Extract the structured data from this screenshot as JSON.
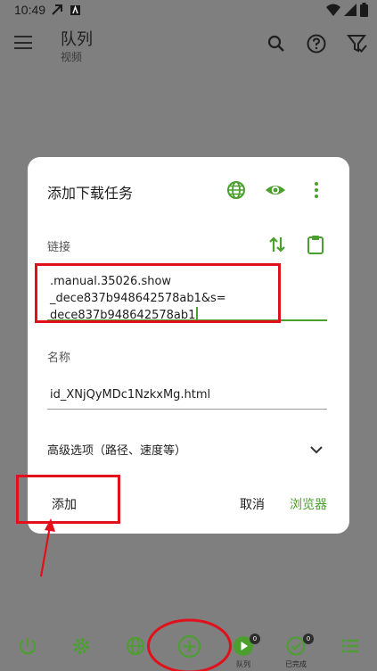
{
  "status_bar": {
    "time": "10:49"
  },
  "app_bar": {
    "title": "队列",
    "subtitle": "视频"
  },
  "dialog": {
    "title": "添加下载任务",
    "link_label": "链接",
    "link_value_line1": ".manual.35026.show",
    "link_value_line2": "_dece837b948642578ab1&s=",
    "link_value_line3": "dece837b948642578ab1",
    "name_label": "名称",
    "name_value": "id_XNjQyMDc1NzkxMg.html",
    "advanced_label": "高级选项（路径、速度等）",
    "add_button": "添加",
    "cancel_button": "取消",
    "browser_button": "浏览器"
  },
  "bottom_nav": {
    "queue_label": "队列",
    "queue_badge": "0",
    "done_label": "已完成",
    "done_badge": "0"
  },
  "colors": {
    "accent": "#4b9f2f",
    "highlight": "#e0111b",
    "scrim": "#7f7f7f"
  }
}
